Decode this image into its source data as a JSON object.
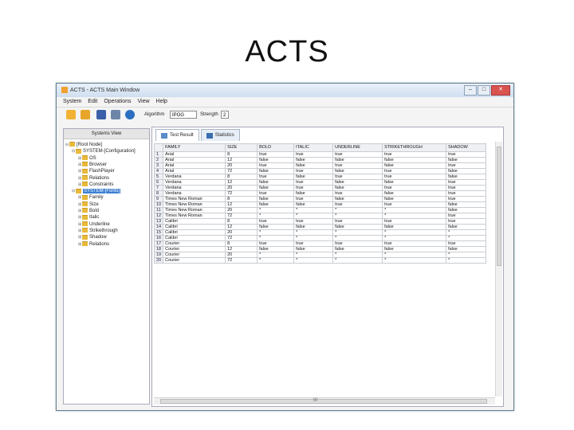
{
  "slide": {
    "title": "ACTS"
  },
  "window": {
    "title": "ACTS - ACTS Main Window",
    "buttons": [
      "–",
      "□",
      "✕"
    ]
  },
  "menu": [
    "System",
    "Edit",
    "Operations",
    "View",
    "Help"
  ],
  "toolbar": {
    "algorithm_label": "Algorithm",
    "algorithm_value": "IPOG",
    "strength_label": "Strength",
    "strength_value": "2",
    "icons": [
      "new-icon",
      "open-icon",
      "save-icon",
      "build-icon",
      "help-icon"
    ]
  },
  "sidebar": {
    "header": "Systems View",
    "tree": [
      {
        "label": "[Root Node]",
        "toggle": "⊟",
        "folder": true
      },
      {
        "label": "SYSTEM-[Configuration]",
        "toggle": "⊟",
        "folder": true
      },
      {
        "label": "OS",
        "toggle": "⊞",
        "folder": true
      },
      {
        "label": "Browser",
        "toggle": "⊞",
        "folder": true
      },
      {
        "label": "FlashPlayer",
        "toggle": "⊞",
        "folder": true
      },
      {
        "label": "Relations",
        "toggle": "⊞",
        "folder": true
      },
      {
        "label": "Constraints",
        "toggle": "⊞",
        "folder": true
      },
      {
        "label": "SYSTEM-[Fonts]",
        "toggle": "⊟",
        "folder": true,
        "selected": true
      },
      {
        "label": "Family",
        "toggle": "⊞",
        "folder": true
      },
      {
        "label": "Size",
        "toggle": "⊞",
        "folder": true
      },
      {
        "label": "Bold",
        "toggle": "⊞",
        "folder": true
      },
      {
        "label": "Italic",
        "toggle": "⊞",
        "folder": true
      },
      {
        "label": "Underline",
        "toggle": "⊞",
        "folder": true
      },
      {
        "label": "Strikethrough",
        "toggle": "⊞",
        "folder": true
      },
      {
        "label": "Shadow",
        "toggle": "⊞",
        "folder": true
      },
      {
        "label": "Relations",
        "toggle": "⊞",
        "folder": true
      }
    ]
  },
  "tabs": [
    {
      "label": "Test Result",
      "active": true
    },
    {
      "label": "Statistics",
      "active": false
    }
  ],
  "table": {
    "columns": [
      "",
      "FAMILY",
      "SIZE",
      "BOLD",
      "ITALIC",
      "UNDERLINE",
      "STRIKETHROUGH",
      "SHADOW"
    ],
    "rows": [
      [
        "1",
        "Arial",
        "8",
        "true",
        "true",
        "true",
        "true",
        "true"
      ],
      [
        "2",
        "Arial",
        "12",
        "false",
        "false",
        "false",
        "false",
        "false"
      ],
      [
        "3",
        "Arial",
        "20",
        "true",
        "false",
        "true",
        "false",
        "true"
      ],
      [
        "4",
        "Arial",
        "72",
        "false",
        "true",
        "false",
        "true",
        "false"
      ],
      [
        "5",
        "Verdana",
        "8",
        "true",
        "false",
        "true",
        "true",
        "false"
      ],
      [
        "6",
        "Verdana",
        "12",
        "false",
        "true",
        "false",
        "false",
        "true"
      ],
      [
        "7",
        "Verdana",
        "20",
        "false",
        "true",
        "false",
        "true",
        "true"
      ],
      [
        "8",
        "Verdana",
        "72",
        "true",
        "false",
        "true",
        "false",
        "true"
      ],
      [
        "9",
        "Times New Roman",
        "8",
        "false",
        "true",
        "false",
        "false",
        "true"
      ],
      [
        "10",
        "Times New Roman",
        "12",
        "false",
        "false",
        "true",
        "true",
        "false"
      ],
      [
        "11",
        "Times New Roman",
        "20",
        "*",
        "*",
        "*",
        "*",
        "false"
      ],
      [
        "12",
        "Times New Roman",
        "72",
        "*",
        "*",
        "*",
        "*",
        "true"
      ],
      [
        "13",
        "Calibri",
        "8",
        "true",
        "true",
        "true",
        "true",
        "true"
      ],
      [
        "14",
        "Calibri",
        "12",
        "false",
        "false",
        "false",
        "false",
        "false"
      ],
      [
        "15",
        "Calibri",
        "20",
        "*",
        "*",
        "*",
        "*",
        "*"
      ],
      [
        "16",
        "Calibri",
        "72",
        "*",
        "*",
        "*",
        "*",
        "*"
      ],
      [
        "17",
        "Courier",
        "8",
        "true",
        "true",
        "true",
        "true",
        "true"
      ],
      [
        "18",
        "Courier",
        "12",
        "false",
        "false",
        "false",
        "false",
        "false"
      ],
      [
        "19",
        "Courier",
        "20",
        "*",
        "*",
        "*",
        "*",
        "*"
      ],
      [
        "20",
        "Courier",
        "72",
        "*",
        "*",
        "*",
        "*",
        "*"
      ]
    ]
  },
  "hscroll_grip": "III"
}
